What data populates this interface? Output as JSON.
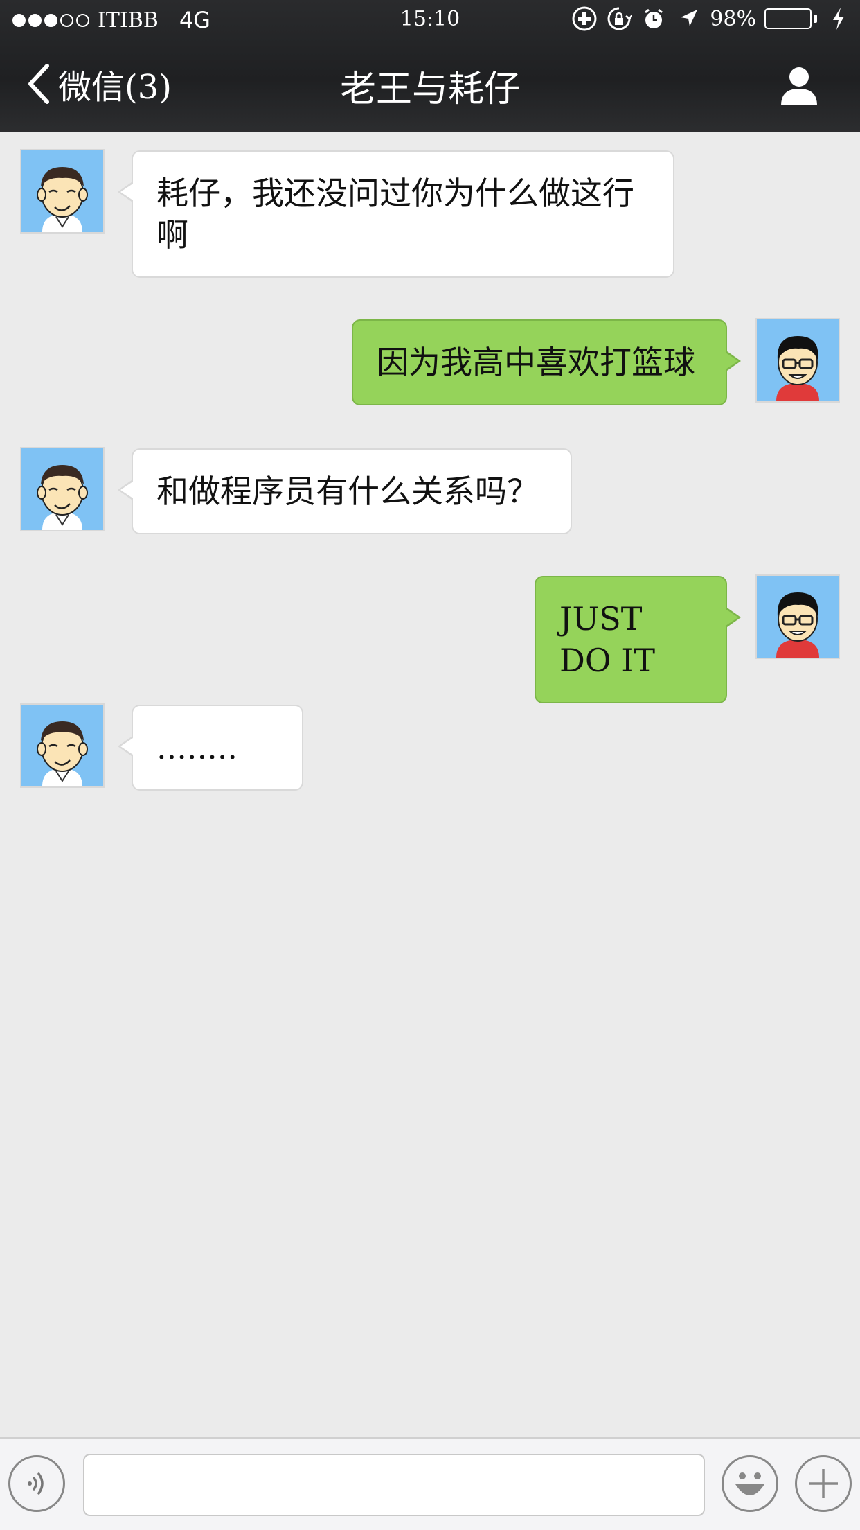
{
  "status_bar": {
    "signal_filled": 3,
    "signal_total": 5,
    "carrier": "ITIBB",
    "network": "4G",
    "time": "15:10",
    "battery_percent": "98%",
    "battery_level": 0.98,
    "battery_color": "#4cd964"
  },
  "nav": {
    "back_label": "微信(3)",
    "title": "老王与耗仔",
    "profile_icon": "person-icon"
  },
  "messages": [
    {
      "sender": "other",
      "avatar": "laowang-avatar",
      "text_line1": "耗仔，我还没问过你为什么做这行",
      "text_line2": "啊"
    },
    {
      "sender": "me",
      "avatar": "haozai-avatar",
      "text": "因为我高中喜欢打篮球"
    },
    {
      "sender": "other",
      "avatar": "laowang-avatar",
      "text": "和做程序员有什么关系吗？"
    },
    {
      "sender": "me",
      "avatar": "haozai-avatar",
      "text": "JUST DO IT"
    },
    {
      "sender": "other",
      "avatar": "laowang-avatar",
      "text": "........"
    }
  ],
  "input_bar": {
    "voice_icon": "voice-icon",
    "input_value": "",
    "emoji_icon": "emoji-icon",
    "plus_icon": "plus-icon"
  },
  "colors": {
    "bubble_out": "#95d35a",
    "bubble_in": "#ffffff",
    "avatar_bg": "#7fc2f4",
    "chat_bg": "#ebebeb"
  }
}
